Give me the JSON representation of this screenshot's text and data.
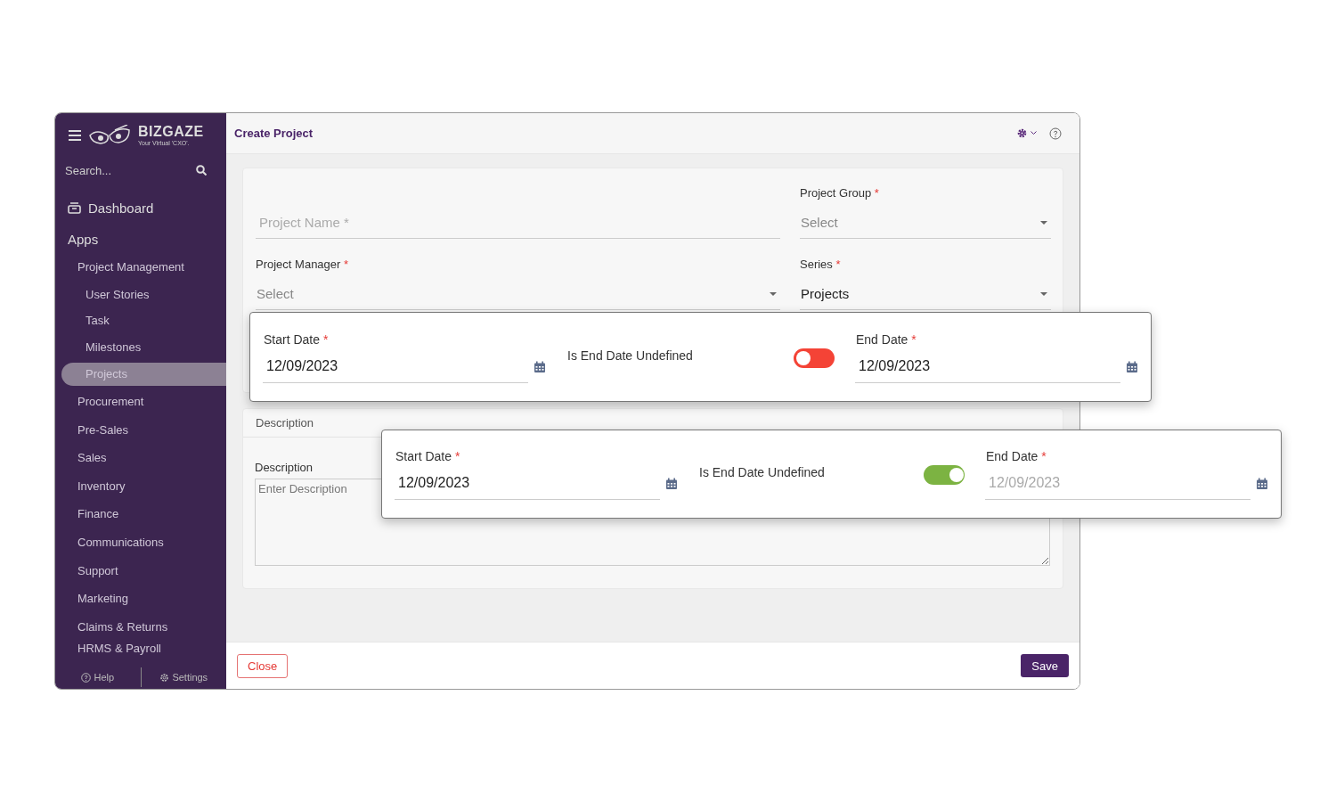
{
  "sidebar": {
    "brand": {
      "name": "BIZGAZE",
      "tagline": "Your Virtual 'CXO'."
    },
    "search": {
      "placeholder": "Search..."
    },
    "dashboard": "Dashboard",
    "section": "Apps",
    "items": [
      {
        "label": "Project Management",
        "selected": false,
        "children": [
          {
            "label": "User Stories",
            "selected": false
          },
          {
            "label": "Task",
            "selected": false
          },
          {
            "label": "Milestones",
            "selected": false
          },
          {
            "label": "Projects",
            "selected": true
          }
        ]
      },
      {
        "label": "Procurement",
        "selected": false
      },
      {
        "label": "Pre-Sales",
        "selected": false
      },
      {
        "label": "Sales",
        "selected": false
      },
      {
        "label": "Inventory",
        "selected": false
      },
      {
        "label": "Finance",
        "selected": false
      },
      {
        "label": "Communications",
        "selected": false
      },
      {
        "label": "Support",
        "selected": false
      },
      {
        "label": "Marketing",
        "selected": false
      },
      {
        "label": "Claims & Returns",
        "selected": false
      },
      {
        "label": "HRMS & Payroll",
        "selected": false
      }
    ],
    "footer": {
      "help": "Help",
      "settings": "Settings"
    }
  },
  "header": {
    "title": "Create Project"
  },
  "form": {
    "fields": [
      {
        "kind": "text",
        "placeholder": "Project Name *"
      },
      {
        "kind": "select",
        "label": "Project Manager",
        "mark": "*",
        "placeholder": "Select"
      },
      {
        "kind": "select",
        "label": "Project Group",
        "mark": "*",
        "placeholder": "Select"
      },
      {
        "kind": "select",
        "label": "Series",
        "mark": "*",
        "value": "Projects"
      }
    ]
  },
  "description": {
    "heading": "Description",
    "label": "Description",
    "placeholder": "Enter Description"
  },
  "date_cards": [
    {
      "start": {
        "label": "Start Date",
        "mark": "*",
        "value": "12/09/2023"
      },
      "toggle": {
        "label": "Is End Date Undefined",
        "on": false
      },
      "end": {
        "label": "End Date",
        "mark": "*",
        "value": "12/09/2023",
        "disabled": false
      }
    },
    {
      "start": {
        "label": "Start Date",
        "mark": "*",
        "value": "12/09/2023"
      },
      "toggle": {
        "label": "Is End Date Undefined",
        "on": true
      },
      "end": {
        "label": "End Date",
        "mark": "*",
        "value": "12/09/2023",
        "disabled": true
      }
    }
  ],
  "buttons": {
    "close": "Close",
    "save": "Save"
  }
}
